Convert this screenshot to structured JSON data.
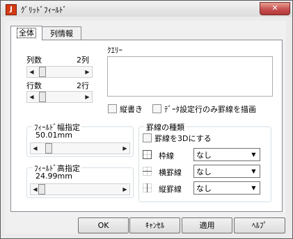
{
  "window": {
    "title": "ｸﾞﾘｯﾄﾞﾌｨｰﾙﾄﾞ",
    "icon_letter": "J",
    "close_glyph": "✕",
    "accent": "#c75050"
  },
  "tabs": [
    {
      "label": "全体",
      "active": true
    },
    {
      "label": "列情報",
      "active": false
    }
  ],
  "columns": {
    "label": "列数",
    "value": "2列"
  },
  "rows": {
    "label": "行数",
    "value": "2行"
  },
  "query": {
    "label": "ｸｴﾘｰ",
    "value": ""
  },
  "checks": {
    "vertical": {
      "label": "縦書き",
      "checked": false
    },
    "data_rows_only": {
      "label": "ﾃﾞｰﾀ設定行のみ罫線を描画",
      "checked": false
    }
  },
  "field_width": {
    "group_label": "ﾌｨｰﾙﾄﾞ幅指定",
    "value": "50.01mm"
  },
  "field_height": {
    "group_label": "ﾌｨｰﾙﾄﾞ高指定",
    "value": "24.99mm"
  },
  "lines": {
    "group_label": "罫線の種類",
    "three_d": {
      "label": "罫線を3Dにする",
      "checked": false
    },
    "frame": {
      "label": "枠線",
      "value": "なし"
    },
    "horizontal": {
      "label": "横罫線",
      "value": "なし"
    },
    "vertical": {
      "label": "縦罫線",
      "value": "なし"
    }
  },
  "buttons": {
    "ok": "OK",
    "cancel": "ｷｬﾝｾﾙ",
    "apply": "適用",
    "help": "ﾍﾙﾌﾟ"
  }
}
